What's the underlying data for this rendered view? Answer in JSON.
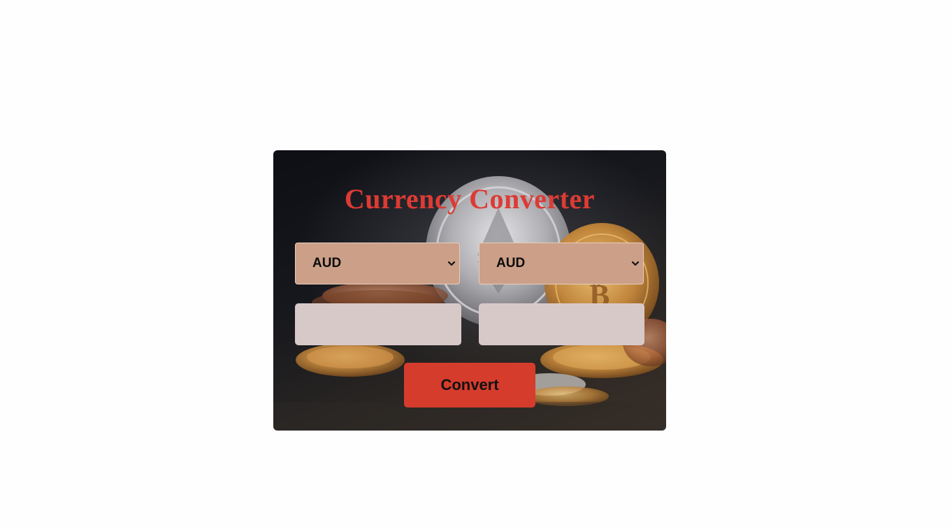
{
  "converter": {
    "title": "Currency Converter",
    "from_currency": "AUD",
    "to_currency": "AUD",
    "from_amount": "",
    "to_amount": "",
    "convert_label": "Convert"
  },
  "colors": {
    "title": "#dc3b34",
    "select_bg": "#cc9f88",
    "input_bg": "#d8c9c9",
    "button_bg": "#d63c2c"
  },
  "icons": {
    "dropdown": "chevron-down-icon",
    "background": "crypto-coins-image"
  }
}
